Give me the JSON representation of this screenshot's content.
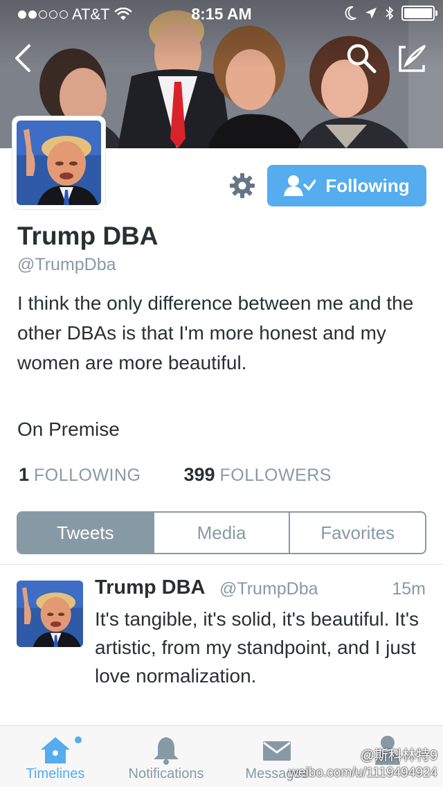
{
  "status_bar": {
    "carrier": "AT&T",
    "time": "8:15 AM",
    "signal_bars_filled": 2,
    "signal_bars_total": 5,
    "battery_level": 1.0
  },
  "nav": {
    "back_icon": "chevron-left-icon",
    "search_icon": "search-icon",
    "compose_icon": "compose-icon"
  },
  "profile": {
    "name": "Trump DBA",
    "handle": "@TrumpDba",
    "bio": "I think the only difference between me and the other DBAs is that I'm more honest and my women are more beautiful.",
    "location": "On Premise",
    "follow_button_label": "Following",
    "following_count": "1",
    "following_label": "FOLLOWING",
    "followers_count": "399",
    "followers_label": "FOLLOWERS"
  },
  "tabs": [
    {
      "label": "Tweets",
      "active": true
    },
    {
      "label": "Media",
      "active": false
    },
    {
      "label": "Favorites",
      "active": false
    }
  ],
  "tweet": {
    "name": "Trump DBA",
    "handle": "@TrumpDba",
    "time": "15m",
    "text": "It's tangible, it's solid, it's beautiful. It's artistic, from my standpoint, and I just love normalization."
  },
  "tabbar": {
    "items": [
      {
        "label": "Timelines",
        "icon": "home-icon",
        "active": true
      },
      {
        "label": "Notifications",
        "icon": "bell-icon",
        "active": false
      },
      {
        "label": "Messages",
        "icon": "envelope-icon",
        "active": false
      },
      {
        "label": "",
        "icon": "person-icon",
        "active": false
      }
    ]
  },
  "watermark": {
    "line1": "@斯科林特9",
    "line2": "weibo.com/u/1119494924"
  },
  "colors": {
    "accent": "#55acee",
    "text": "#292f33",
    "muted": "#8899a6"
  }
}
